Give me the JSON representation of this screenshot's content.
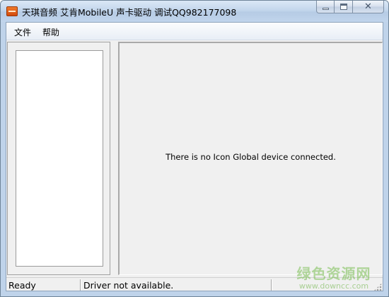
{
  "window": {
    "title": "天琪音频 艾肯MobileU 声卡驱动 调试QQ982177098",
    "close_glyph": "✕"
  },
  "menu": {
    "items": [
      {
        "label": "文件"
      },
      {
        "label": "帮助"
      }
    ]
  },
  "main": {
    "message": "There is no Icon Global device connected."
  },
  "statusbar": {
    "state": "Ready",
    "driver": "Driver not available."
  },
  "watermark": {
    "main": "绿色资源网",
    "sub": "www.downcc.com"
  },
  "colors": {
    "titlebar": "#c3d6ec",
    "client": "#f0f0f0",
    "list_bg": "#ffffff",
    "app_icon": "#e0601a",
    "watermark": "#78be50"
  },
  "icons": {
    "app": "app-icon",
    "minimize": "minimize-icon",
    "maximize": "maximize-icon",
    "close": "close-icon",
    "grip": "resize-grip-icon"
  }
}
